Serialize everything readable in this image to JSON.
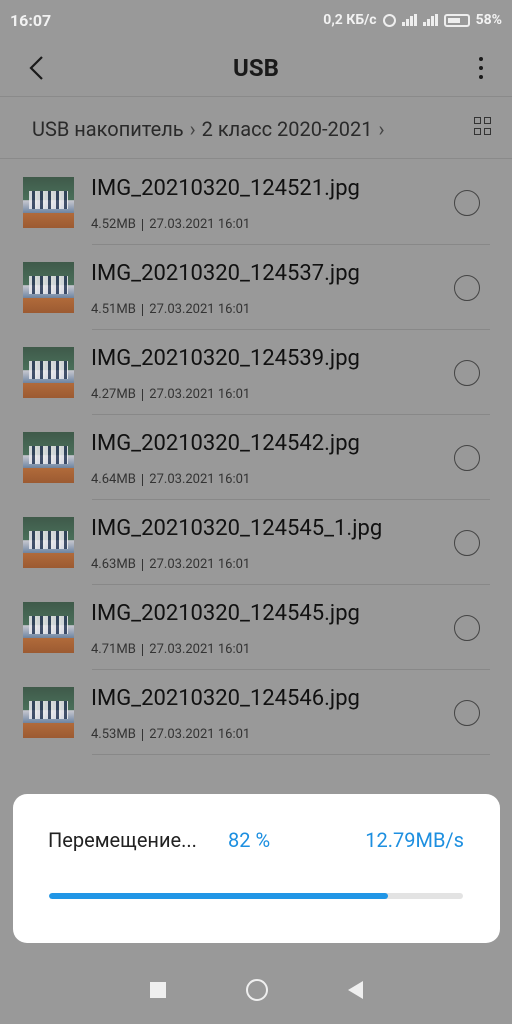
{
  "status": {
    "time": "16:07",
    "net_speed": "0,2 КБ/с",
    "battery": "58%"
  },
  "app_bar": {
    "title": "USB",
    "icons": [
      "back-arrow-icon",
      "more-vertical-icon"
    ]
  },
  "breadcrumb": {
    "items": [
      "USB накопитель",
      "2 класс 2020-2021"
    ],
    "view_icon": "grid-view-icon"
  },
  "files": [
    {
      "name": "IMG_20210320_124521.jpg",
      "size": "4.52MB",
      "date": "27.03.2021 16:01"
    },
    {
      "name": "IMG_20210320_124537.jpg",
      "size": "4.51MB",
      "date": "27.03.2021 16:01"
    },
    {
      "name": "IMG_20210320_124539.jpg",
      "size": "4.27MB",
      "date": "27.03.2021 16:01"
    },
    {
      "name": "IMG_20210320_124542.jpg",
      "size": "4.64MB",
      "date": "27.03.2021 16:01"
    },
    {
      "name": "IMG_20210320_124545_1.jpg",
      "size": "4.63MB",
      "date": "27.03.2021 16:01"
    },
    {
      "name": "IMG_20210320_124545.jpg",
      "size": "4.71MB",
      "date": "27.03.2021 16:01"
    },
    {
      "name": "IMG_20210320_124546.jpg",
      "size": "4.53MB",
      "date": "27.03.2021 16:01"
    }
  ],
  "dialog": {
    "label": "Перемещение...",
    "percent_text": "82 %",
    "speed": "12.79MB/s",
    "progress": 0.82
  },
  "nav": {
    "icons": [
      "recents-square-icon",
      "home-circle-icon",
      "back-triangle-icon"
    ]
  },
  "colors": {
    "accent": "#1d8fe0",
    "progress_fill": "#2196e6",
    "scrim_background": "#999999"
  }
}
